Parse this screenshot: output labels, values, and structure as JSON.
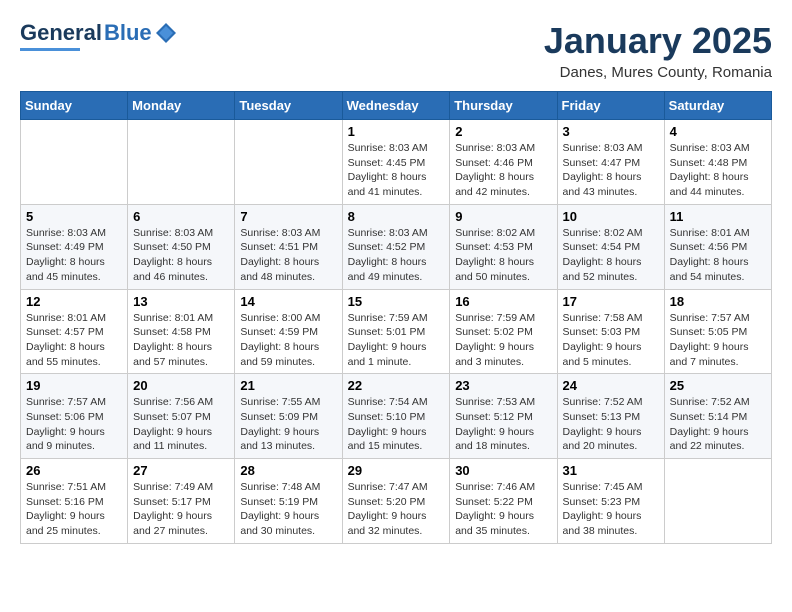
{
  "logo": {
    "part1": "General",
    "part2": "Blue"
  },
  "title": "January 2025",
  "subtitle": "Danes, Mures County, Romania",
  "days_header": [
    "Sunday",
    "Monday",
    "Tuesday",
    "Wednesday",
    "Thursday",
    "Friday",
    "Saturday"
  ],
  "weeks": [
    [
      {
        "day": "",
        "info": ""
      },
      {
        "day": "",
        "info": ""
      },
      {
        "day": "",
        "info": ""
      },
      {
        "day": "1",
        "info": "Sunrise: 8:03 AM\nSunset: 4:45 PM\nDaylight: 8 hours and 41 minutes."
      },
      {
        "day": "2",
        "info": "Sunrise: 8:03 AM\nSunset: 4:46 PM\nDaylight: 8 hours and 42 minutes."
      },
      {
        "day": "3",
        "info": "Sunrise: 8:03 AM\nSunset: 4:47 PM\nDaylight: 8 hours and 43 minutes."
      },
      {
        "day": "4",
        "info": "Sunrise: 8:03 AM\nSunset: 4:48 PM\nDaylight: 8 hours and 44 minutes."
      }
    ],
    [
      {
        "day": "5",
        "info": "Sunrise: 8:03 AM\nSunset: 4:49 PM\nDaylight: 8 hours and 45 minutes."
      },
      {
        "day": "6",
        "info": "Sunrise: 8:03 AM\nSunset: 4:50 PM\nDaylight: 8 hours and 46 minutes."
      },
      {
        "day": "7",
        "info": "Sunrise: 8:03 AM\nSunset: 4:51 PM\nDaylight: 8 hours and 48 minutes."
      },
      {
        "day": "8",
        "info": "Sunrise: 8:03 AM\nSunset: 4:52 PM\nDaylight: 8 hours and 49 minutes."
      },
      {
        "day": "9",
        "info": "Sunrise: 8:02 AM\nSunset: 4:53 PM\nDaylight: 8 hours and 50 minutes."
      },
      {
        "day": "10",
        "info": "Sunrise: 8:02 AM\nSunset: 4:54 PM\nDaylight: 8 hours and 52 minutes."
      },
      {
        "day": "11",
        "info": "Sunrise: 8:01 AM\nSunset: 4:56 PM\nDaylight: 8 hours and 54 minutes."
      }
    ],
    [
      {
        "day": "12",
        "info": "Sunrise: 8:01 AM\nSunset: 4:57 PM\nDaylight: 8 hours and 55 minutes."
      },
      {
        "day": "13",
        "info": "Sunrise: 8:01 AM\nSunset: 4:58 PM\nDaylight: 8 hours and 57 minutes."
      },
      {
        "day": "14",
        "info": "Sunrise: 8:00 AM\nSunset: 4:59 PM\nDaylight: 8 hours and 59 minutes."
      },
      {
        "day": "15",
        "info": "Sunrise: 7:59 AM\nSunset: 5:01 PM\nDaylight: 9 hours and 1 minute."
      },
      {
        "day": "16",
        "info": "Sunrise: 7:59 AM\nSunset: 5:02 PM\nDaylight: 9 hours and 3 minutes."
      },
      {
        "day": "17",
        "info": "Sunrise: 7:58 AM\nSunset: 5:03 PM\nDaylight: 9 hours and 5 minutes."
      },
      {
        "day": "18",
        "info": "Sunrise: 7:57 AM\nSunset: 5:05 PM\nDaylight: 9 hours and 7 minutes."
      }
    ],
    [
      {
        "day": "19",
        "info": "Sunrise: 7:57 AM\nSunset: 5:06 PM\nDaylight: 9 hours and 9 minutes."
      },
      {
        "day": "20",
        "info": "Sunrise: 7:56 AM\nSunset: 5:07 PM\nDaylight: 9 hours and 11 minutes."
      },
      {
        "day": "21",
        "info": "Sunrise: 7:55 AM\nSunset: 5:09 PM\nDaylight: 9 hours and 13 minutes."
      },
      {
        "day": "22",
        "info": "Sunrise: 7:54 AM\nSunset: 5:10 PM\nDaylight: 9 hours and 15 minutes."
      },
      {
        "day": "23",
        "info": "Sunrise: 7:53 AM\nSunset: 5:12 PM\nDaylight: 9 hours and 18 minutes."
      },
      {
        "day": "24",
        "info": "Sunrise: 7:52 AM\nSunset: 5:13 PM\nDaylight: 9 hours and 20 minutes."
      },
      {
        "day": "25",
        "info": "Sunrise: 7:52 AM\nSunset: 5:14 PM\nDaylight: 9 hours and 22 minutes."
      }
    ],
    [
      {
        "day": "26",
        "info": "Sunrise: 7:51 AM\nSunset: 5:16 PM\nDaylight: 9 hours and 25 minutes."
      },
      {
        "day": "27",
        "info": "Sunrise: 7:49 AM\nSunset: 5:17 PM\nDaylight: 9 hours and 27 minutes."
      },
      {
        "day": "28",
        "info": "Sunrise: 7:48 AM\nSunset: 5:19 PM\nDaylight: 9 hours and 30 minutes."
      },
      {
        "day": "29",
        "info": "Sunrise: 7:47 AM\nSunset: 5:20 PM\nDaylight: 9 hours and 32 minutes."
      },
      {
        "day": "30",
        "info": "Sunrise: 7:46 AM\nSunset: 5:22 PM\nDaylight: 9 hours and 35 minutes."
      },
      {
        "day": "31",
        "info": "Sunrise: 7:45 AM\nSunset: 5:23 PM\nDaylight: 9 hours and 38 minutes."
      },
      {
        "day": "",
        "info": ""
      }
    ]
  ]
}
